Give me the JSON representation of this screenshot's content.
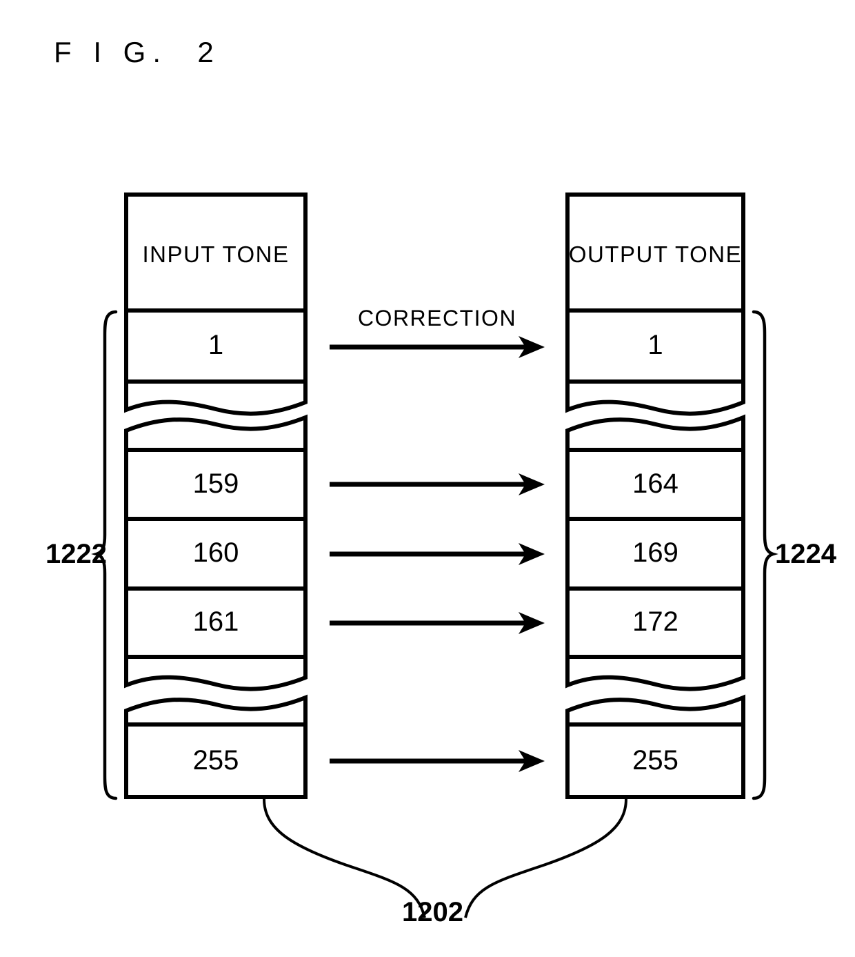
{
  "figure": {
    "title": "F I G.  2"
  },
  "tables": {
    "input": {
      "header": "INPUT TONE",
      "reference": "1222",
      "rows": [
        "1",
        "159",
        "160",
        "161",
        "255"
      ]
    },
    "output": {
      "header": "OUTPUT TONE",
      "reference": "1224",
      "rows": [
        "1",
        "164",
        "169",
        "172",
        "255"
      ]
    }
  },
  "mapping": {
    "arrow_label": "CORRECTION",
    "pairs": [
      {
        "input": "1",
        "output": "1"
      },
      {
        "input": "159",
        "output": "164"
      },
      {
        "input": "160",
        "output": "169"
      },
      {
        "input": "161",
        "output": "172"
      },
      {
        "input": "255",
        "output": "255"
      }
    ]
  },
  "callout": {
    "reference": "1202"
  },
  "colors": {
    "line": "#000000",
    "background": "#ffffff"
  }
}
